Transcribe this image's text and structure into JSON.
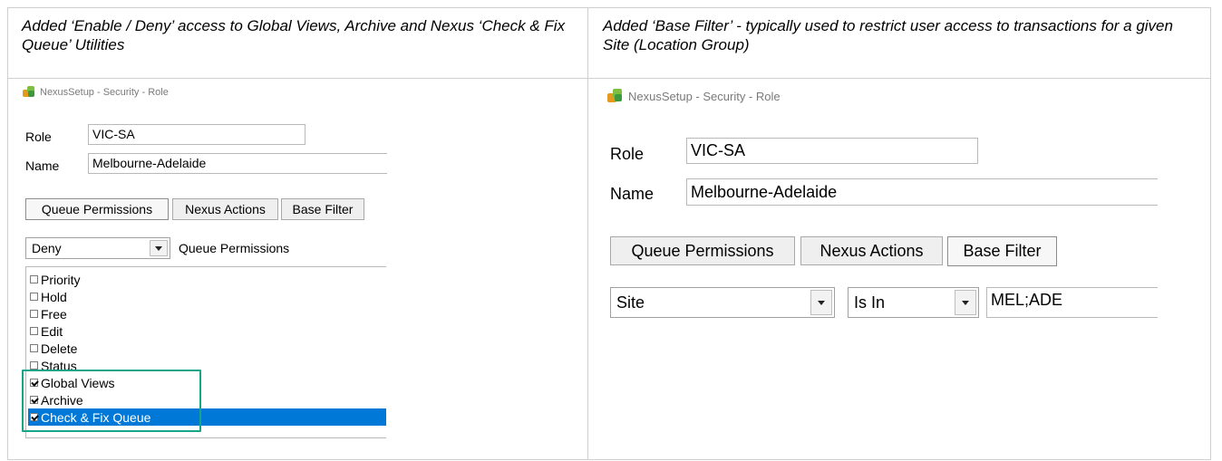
{
  "captions": {
    "left": "Added ‘Enable / Deny’ access to Global Views, Archive and Nexus ‘Check & Fix Queue’ Utilities",
    "right": "Added ‘Base Filter’ - typically used to restrict user access to transactions for a given Site (Location Group)"
  },
  "left_panel": {
    "window_title": "NexusSetup - Security - Role",
    "role_label": "Role",
    "role_value": "VIC-SA",
    "name_label": "Name",
    "name_value": "Melbourne-Adelaide",
    "tabs": [
      "Queue Permissions",
      "Nexus Actions",
      "Base Filter"
    ],
    "permission_mode": "Deny",
    "permission_caption": "Queue Permissions",
    "permissions": [
      {
        "label": "Priority",
        "checked": false
      },
      {
        "label": "Hold",
        "checked": false
      },
      {
        "label": "Free",
        "checked": false
      },
      {
        "label": "Edit",
        "checked": false
      },
      {
        "label": "Delete",
        "checked": false
      },
      {
        "label": "Status",
        "checked": false
      },
      {
        "label": "Global Views",
        "checked": true
      },
      {
        "label": "Archive",
        "checked": true
      },
      {
        "label": "Check & Fix Queue",
        "checked": true,
        "selected": true
      }
    ]
  },
  "right_panel": {
    "window_title": "NexusSetup - Security - Role",
    "role_label": "Role",
    "role_value": "VIC-SA",
    "name_label": "Name",
    "name_value": "Melbourne-Adelaide",
    "tabs": [
      "Queue Permissions",
      "Nexus Actions",
      "Base Filter"
    ],
    "filter_field": "Site",
    "filter_operator": "Is In",
    "filter_value": "MEL;ADE"
  },
  "colors": {
    "highlight_box": "#17a589",
    "selection": "#0078d7"
  }
}
